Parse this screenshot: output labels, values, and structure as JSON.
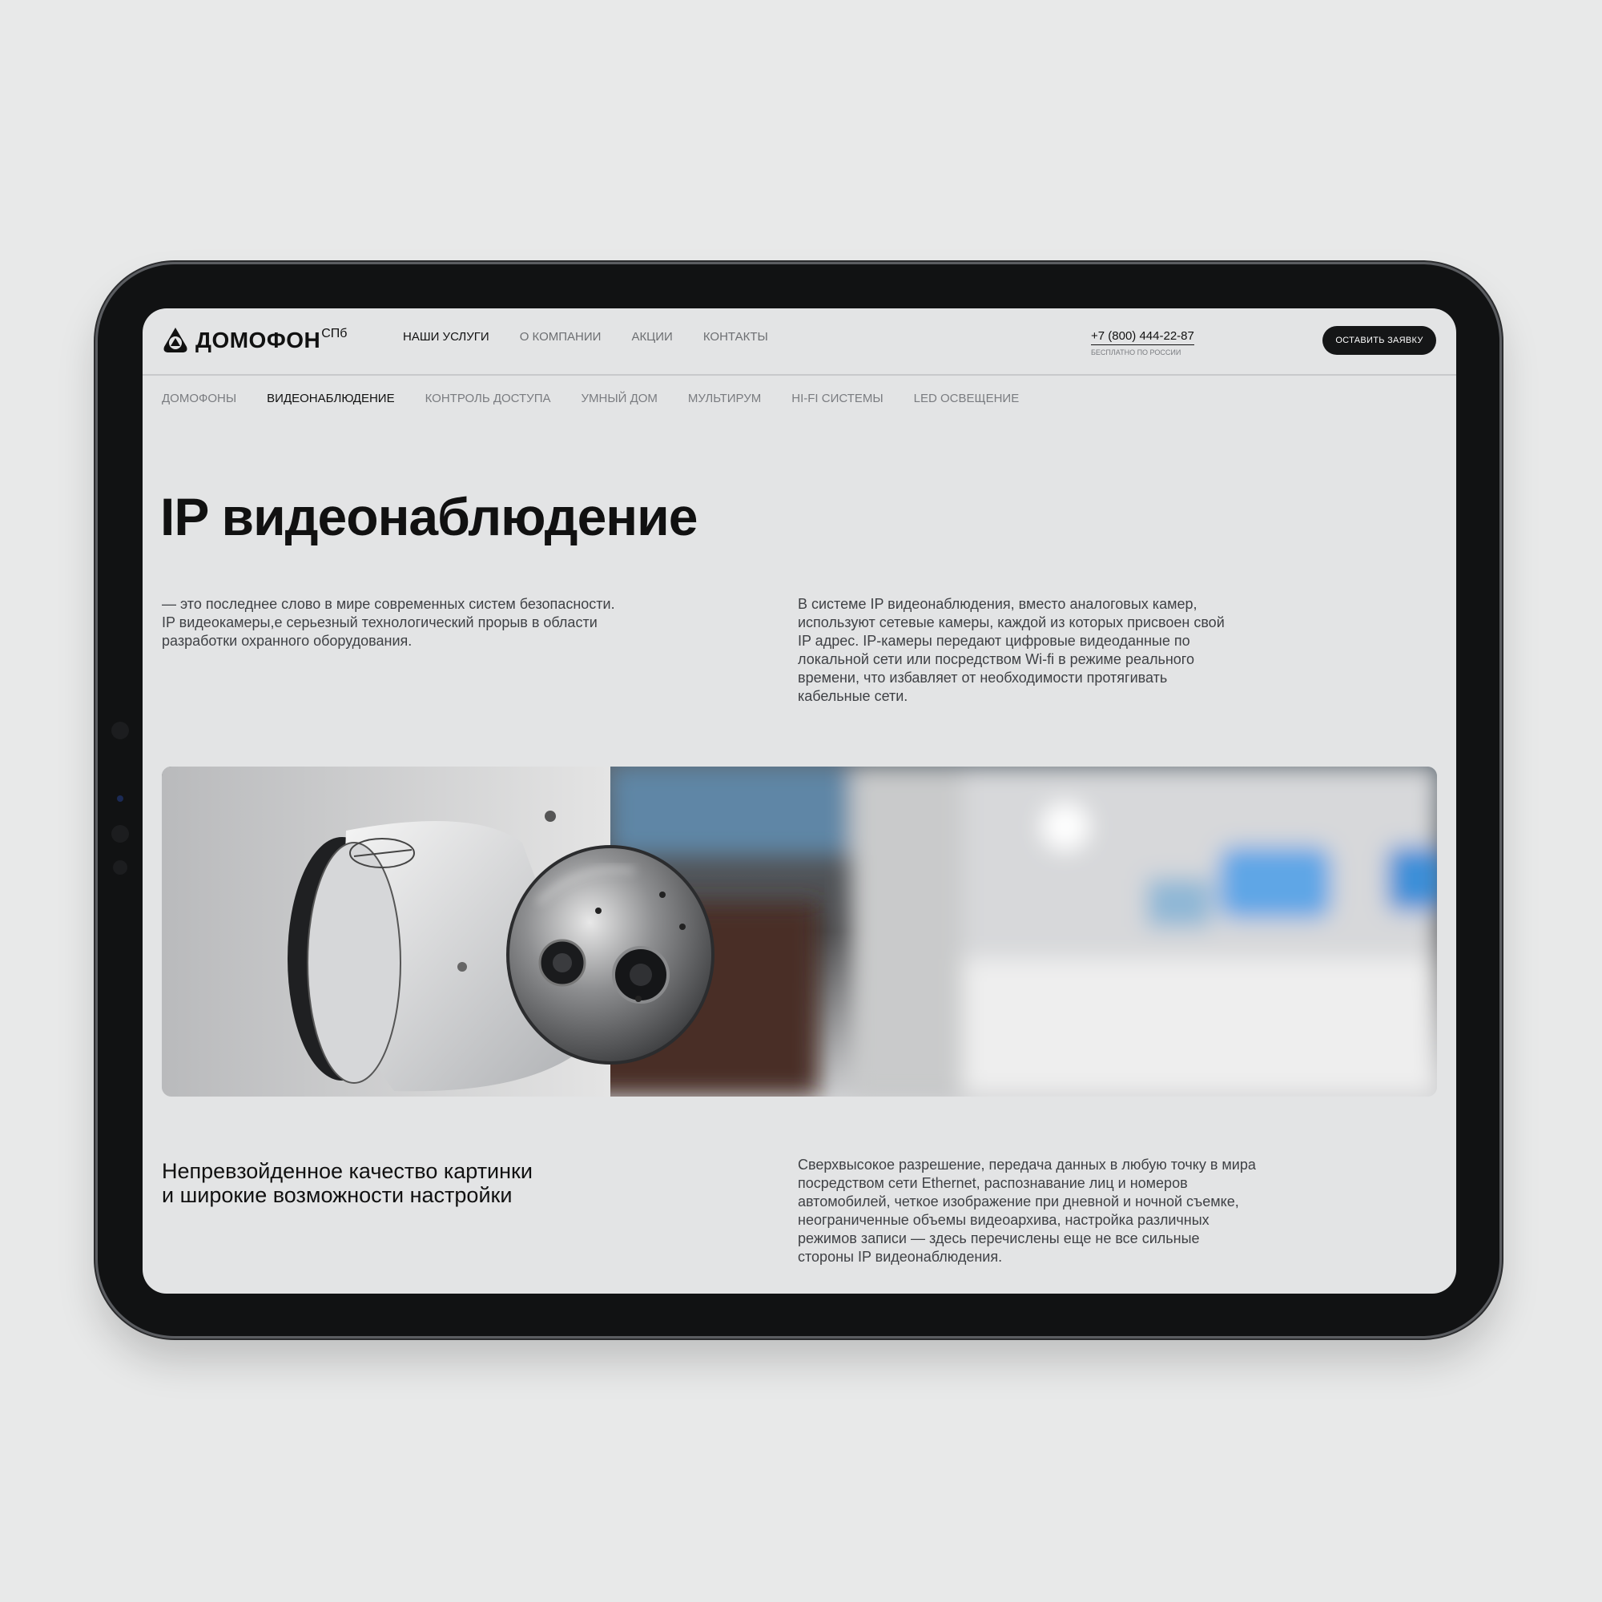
{
  "brand": {
    "name": "ДОМОФОН",
    "suffix": "СПб"
  },
  "nav": {
    "items": [
      {
        "label": "НАШИ УСЛУГИ",
        "active": true
      },
      {
        "label": "О КОМПАНИИ",
        "active": false
      },
      {
        "label": "АКЦИИ",
        "active": false
      },
      {
        "label": "КОНТАКТЫ",
        "active": false
      }
    ]
  },
  "contact": {
    "phone": "+7 (800) 444-22-87",
    "phone_note": "БЕСПЛАТНО ПО РОССИИ",
    "socials": [
      "whatsapp-icon",
      "telegram-icon"
    ],
    "cta_label": "ОСТАВИТЬ ЗАЯВКУ"
  },
  "subnav": {
    "items": [
      {
        "label": "ДОМОФОНЫ",
        "active": false
      },
      {
        "label": "ВИДЕОНАБЛЮДЕНИЕ",
        "active": true
      },
      {
        "label": "КОНТРОЛЬ ДОСТУПА",
        "active": false
      },
      {
        "label": "УМНЫЙ ДОМ",
        "active": false
      },
      {
        "label": "МУЛЬТИРУМ",
        "active": false
      },
      {
        "label": "HI-FI СИСТЕМЫ",
        "active": false
      },
      {
        "label": "LED ОСВЕЩЕНИЕ",
        "active": false
      }
    ]
  },
  "hero": {
    "title": "IP видеонаблюдение",
    "intro_lines": [
      "— это последнее слово в мире современных систем безопасности.",
      "IP видеокамеры,е серьезный технологический прорыв в области",
      "разработки охранного оборудования."
    ],
    "detail_lines": [
      "В системе IP видеонаблюдения, вместо аналоговых камер,",
      "используют сетевые камеры, каждой из которых присвоен свой",
      "IP адрес. IP-камеры передают цифровые видеоданные по",
      "локальной сети или посредством Wi-fi  в режиме реального",
      "времени, что избавляет от необходимости протягивать",
      "кабельные сети."
    ]
  },
  "feature": {
    "heading_lines": [
      "Непревзойденное качество картинки",
      "и широкие возможности настройки"
    ],
    "text_lines": [
      "Сверхвысокое разрешение, передача данных в любую точку в мира",
      "посредством сети Ethernet, распознавание лиц и номеров",
      "автомобилей, четкое изображение при дневной и ночной съемке,",
      "неограниченные объемы видеоархива, настройка различных",
      "режимов записи — здесь перечислены еще не все сильные",
      "стороны IP видеонаблюдения."
    ]
  },
  "colors": {
    "background": "#e8e9e9",
    "device": "#111213",
    "screen": "#e3e4e5",
    "text": "#111111",
    "muted": "#7a7c80"
  }
}
